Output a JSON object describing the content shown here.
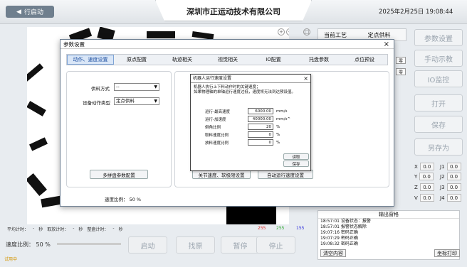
{
  "topbar": {
    "run_label": "行启动",
    "company": "深圳市正运动技术有限公司",
    "datetime": "2025年2月25日  19:08:44"
  },
  "process": {
    "label": "当前工艺",
    "value": "定点供料"
  },
  "right_buttons": [
    "参数设置",
    "手动示教",
    "IO监控",
    "打开",
    "保存",
    "另存为"
  ],
  "coords": [
    {
      "axis": "X",
      "value": "0.0"
    },
    {
      "axis": "J1",
      "value": "0.0"
    },
    {
      "axis": "Y",
      "value": "0.0"
    },
    {
      "axis": "J2",
      "value": "0.0"
    },
    {
      "axis": "Z",
      "value": "0.0"
    },
    {
      "axis": "J3",
      "value": "0.0"
    },
    {
      "axis": "V",
      "value": "0.0"
    },
    {
      "axis": "J4",
      "value": "0.0"
    }
  ],
  "output": {
    "title": "输出窗格",
    "lines": [
      "18:57:01  设备状态：报警",
      "18:57:01  报警状态解除",
      "19:07:16  密码正确",
      "19:07:29  密码正确",
      "19:08:32  密码正确"
    ],
    "clear_label": "清空内容",
    "print_label": "坐标打印"
  },
  "stats": {
    "avg_label": "平均计时：",
    "avg_value": "-",
    "avg_unit": "秒",
    "pick_label": "取放计时：",
    "pick_value": "-",
    "pick_unit": "秒",
    "tray_label": "整盘计时：",
    "tray_value": "-",
    "tray_unit": "秒",
    "c1": "255",
    "c2": "255",
    "c3": "155"
  },
  "speed_main": "速度比例：  50 %",
  "bottom_buttons": [
    "启动",
    "找原",
    "暂停",
    "停止"
  ],
  "status": "试用中",
  "zoom": [
    "+",
    "−",
    "□"
  ],
  "modal": {
    "title": "参数设置",
    "close": "×",
    "tabs": [
      "动作、速度设置",
      "原点配置",
      "轨迹相关",
      "视觉相关",
      "IO配置",
      "托盘参数",
      "点位预设"
    ],
    "feed_mode_label": "供料方式",
    "feed_mode_value": "--",
    "action_type_label": "设备动作类型",
    "action_type_value": "定点供料",
    "multi_tray_btn": "多拼盘参数配置",
    "joint_btn": "关节速度、软极限设置",
    "auto_speed_btn": "自动运行速度设置",
    "speed_ratio": "速度比例：  50 %"
  },
  "inner": {
    "title": "机器人运行速度设置",
    "close": "×",
    "desc1": "机器人执行上下料动作时的关键速度；",
    "desc2": "如果物理轴的单轴运行速度过低，速度将无法到达预设值。",
    "params": [
      {
        "label": "运行-最高速度",
        "value": "6000.00",
        "unit": "mm/s"
      },
      {
        "label": "运行-加速度",
        "value": "40000.00",
        "unit": "mm/s^"
      },
      {
        "label": "倒角比例",
        "value": "20",
        "unit": "%"
      },
      {
        "label": "取料速度比例",
        "value": "0",
        "unit": "%"
      },
      {
        "label": "放料速度比例",
        "value": "0",
        "unit": "%"
      }
    ],
    "read_btn": "读取",
    "save_btn": "保存"
  },
  "side_values": [
    "零",
    "零"
  ]
}
